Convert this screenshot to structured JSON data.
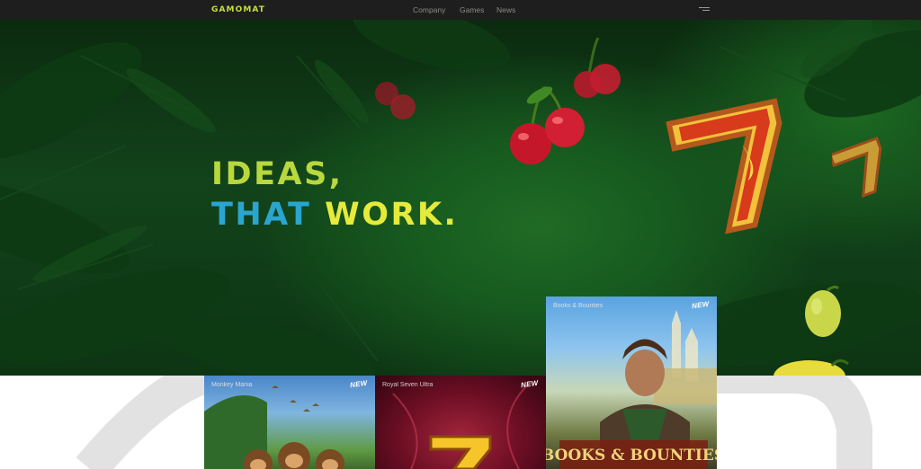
{
  "header": {
    "logo": "GAMOMAT",
    "nav": [
      {
        "label": "Company"
      },
      {
        "label": "Games"
      },
      {
        "label": "News"
      }
    ],
    "menu_icon": "hamburger-menu-icon"
  },
  "hero": {
    "line1": "IDEAS,",
    "line2_a": "THAT",
    "line2_b": "WORK.",
    "colors": {
      "line1": "#b8d83e",
      "that": "#2aa5cf",
      "work": "#e6ea3a"
    }
  },
  "games": [
    {
      "name": "Monkey Mania",
      "badge": "NEW"
    },
    {
      "name": "Royal Seven Ultra",
      "badge": "NEW"
    },
    {
      "name": "Books & Bounties",
      "badge": "NEW",
      "art_text": "BOOKS & BOUNTIES"
    }
  ]
}
